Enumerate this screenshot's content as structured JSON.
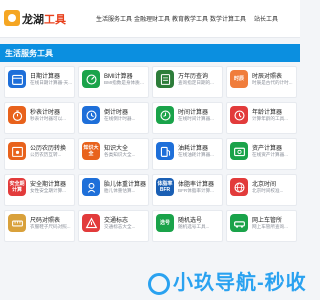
{
  "header": {
    "brand_main": "龙湖",
    "brand_accent": "工具",
    "nav": [
      "生活服务工具",
      "金融理财工具",
      "教育教学工具",
      "数学计算工具",
      "站长工具"
    ]
  },
  "section": {
    "title": "生活服务工具"
  },
  "colors": {
    "banner": "#0b8fe0",
    "accent": "#e8401c"
  },
  "cards": [
    {
      "title": "日期计算器",
      "desc": "在线日期计算器-天...",
      "icon": "calendar-icon",
      "color": "#1e6fd9"
    },
    {
      "title": "BMI计算器",
      "desc": "BMI指数是身体质量...",
      "icon": "bmi-icon",
      "color": "#1aa34a"
    },
    {
      "title": "万年历查询",
      "desc": "查询指定日期的...",
      "icon": "almanac-icon",
      "color": "#2d7d3a"
    },
    {
      "title": "时辰对照表",
      "desc": "时辰是古代的计时...",
      "icon": "time-period-icon",
      "color": "#f07d3c",
      "tile_text": "时辰"
    },
    {
      "title": "秒表计时器",
      "desc": "秒表计时器可以...",
      "icon": "stopwatch-icon",
      "color": "#e8621c"
    },
    {
      "title": "倒计时器",
      "desc": "在线倒计时器...",
      "icon": "countdown-icon",
      "color": "#1e6fd9"
    },
    {
      "title": "时间计算器",
      "desc": "在线时间计算器...",
      "icon": "clock-icon",
      "color": "#1aa34a"
    },
    {
      "title": "年龄计算器",
      "desc": "计算年龄的工具...",
      "icon": "age-icon",
      "color": "#e23b3b"
    },
    {
      "title": "公历农历转换",
      "desc": "公历农历互转...",
      "icon": "lunar-calendar-icon",
      "color": "#e8621c"
    },
    {
      "title": "知识大全",
      "desc": "各类知识大全...",
      "icon": "knowledge-icon",
      "color": "#e8621c",
      "tile_text": "知识大全"
    },
    {
      "title": "油耗计算器",
      "desc": "在线油耗计算器...",
      "icon": "fuel-icon",
      "color": "#1e6fd9"
    },
    {
      "title": "资产计算器",
      "desc": "在线资产计算器...",
      "icon": "asset-icon",
      "color": "#1aa34a"
    },
    {
      "title": "安全期计算器",
      "desc": "女性安全期计算...",
      "icon": "safe-period-icon",
      "color": "#e23b3b",
      "tile_text": "安全期计算"
    },
    {
      "title": "胎儿体重计算器",
      "desc": "胎儿体重估算...",
      "icon": "fetus-icon",
      "color": "#1e6fd9"
    },
    {
      "title": "体脂率计算器",
      "desc": "BFR体脂率计算...",
      "icon": "bfr-icon",
      "color": "#1a5fb4",
      "tile_text": "体脂率BFR"
    },
    {
      "title": "北京时间",
      "desc": "北京时间校准...",
      "icon": "beijing-time-icon",
      "color": "#e23b3b"
    },
    {
      "title": "尺码对照表",
      "desc": "衣服鞋子尺码对照...",
      "icon": "size-chart-icon",
      "color": "#d9a13b"
    },
    {
      "title": "交通标志",
      "desc": "交通标志大全...",
      "icon": "traffic-sign-icon",
      "color": "#e23b3b"
    },
    {
      "title": "随机选号",
      "desc": "随机选号工具...",
      "icon": "random-icon",
      "color": "#1aa34a",
      "tile_text": "选号"
    },
    {
      "title": "网上车管所",
      "desc": "网上车管所查询...",
      "icon": "vehicle-office-icon",
      "color": "#1aa34a"
    }
  ],
  "watermark": {
    "text": "小玖导航-秒收"
  }
}
